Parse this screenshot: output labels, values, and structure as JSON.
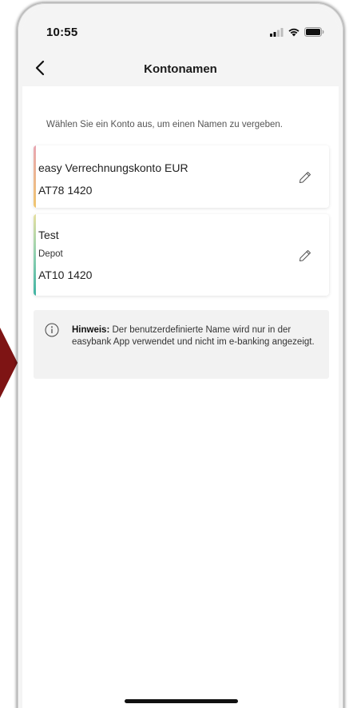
{
  "status_bar": {
    "time": "10:55",
    "icons": [
      "cellular-signal-icon",
      "wifi-icon",
      "battery-icon"
    ]
  },
  "nav": {
    "back_icon": "chevron-left-icon",
    "title": "Kontonamen"
  },
  "intro_text": "Wählen Sie ein Konto aus, um einen Namen zu vergeben.",
  "accounts": [
    {
      "name": "easy Verrechnungskonto EUR",
      "subtitle": "",
      "iban": "AT78 1420",
      "edit_icon": "pencil-icon",
      "accent_colors": [
        "#e8a6b3",
        "#f0c66e"
      ]
    },
    {
      "name": "Test",
      "subtitle": "Depot",
      "iban": "AT10 1420",
      "edit_icon": "pencil-icon",
      "accent_colors": [
        "#e6e0a0",
        "#8fd0b0",
        "#3fb3a3"
      ]
    }
  ],
  "hint": {
    "icon": "info-icon",
    "label": "Hinweis:",
    "text": " Der benutzerdefinierte Name wird nur in der easybank App verwendet und nicht im e-banking angezeigt."
  },
  "colors": {
    "header_bg": "#f4f4f4",
    "hint_bg": "#f2f2f2",
    "page_bg": "#ffffff",
    "edge_arrow": "#7e1414"
  }
}
